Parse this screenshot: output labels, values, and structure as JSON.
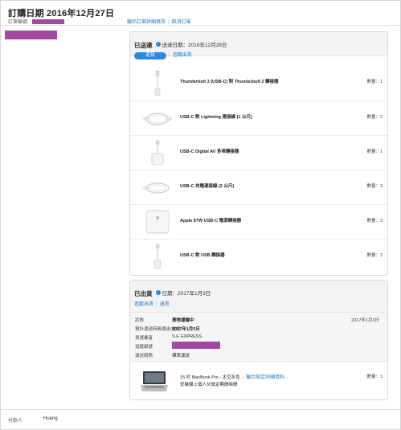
{
  "header": {
    "title": "訂購日期 2016年12月27日",
    "order_no_label": "訂單編號:",
    "links": [
      "顯示訂單詳細資訊",
      "取消訂單"
    ]
  },
  "shipments": [
    {
      "status": "已送達",
      "date_text": "送達日期：2016年12月28日",
      "primary_button": "退貨",
      "secondary_link": "追蹤出貨",
      "items": [
        {
          "name": "Thunderbolt 3 (USB-C) 對 Thunderbolt 2 轉接器",
          "qty": "數量：1",
          "icon": "thunderbolt-adapter-icon"
        },
        {
          "name": "USB-C 對 Lightning 連接線 (1 公尺)",
          "qty": "數量：2",
          "icon": "cable-coil-icon"
        },
        {
          "name": "USB-C Digital AV 多埠轉接器",
          "qty": "數量：1",
          "icon": "multiport-adapter-icon"
        },
        {
          "name": "USB-C 充電連接線 (2 公尺)",
          "qty": "數量：3",
          "icon": "charge-cable-icon"
        },
        {
          "name": "Apple 87W USB-C 電源轉接器",
          "qty": "數量：3",
          "icon": "power-adapter-icon"
        },
        {
          "name": "USB-C 對 USB 轉接器",
          "qty": "數量：2",
          "icon": "usb-adapter-icon"
        }
      ]
    },
    {
      "status": "已出貨",
      "date_text": "日期：2017年1月3日",
      "links": [
        "追蹤出貨",
        "退貨"
      ],
      "details": [
        {
          "label": "狀態",
          "value": "貨物運輸中",
          "extra": "2017年1月3日"
        },
        {
          "label": "預計運送時間運送/送貨",
          "value": "2017年1月5日"
        },
        {
          "label": "貨運業者",
          "value": "S.F. EXPRESS"
        },
        {
          "label": "追蹤編號",
          "value": ""
        },
        {
          "label": "運送服務",
          "value": "標準運送"
        }
      ],
      "item": {
        "name": "15 吋 MacBook Pro - 太空灰色",
        "link": "顯示設定詳細資料",
        "sublink": "安裝線上個人化設定期間時間",
        "qty": "數量：1",
        "icon": "macbook-pro-icon"
      }
    }
  ],
  "footer": {
    "label": "付款人",
    "value": "Huang"
  },
  "colors": {
    "accent": "#2d89e0",
    "link": "#1a73c8",
    "redaction": "#a04aa3"
  }
}
